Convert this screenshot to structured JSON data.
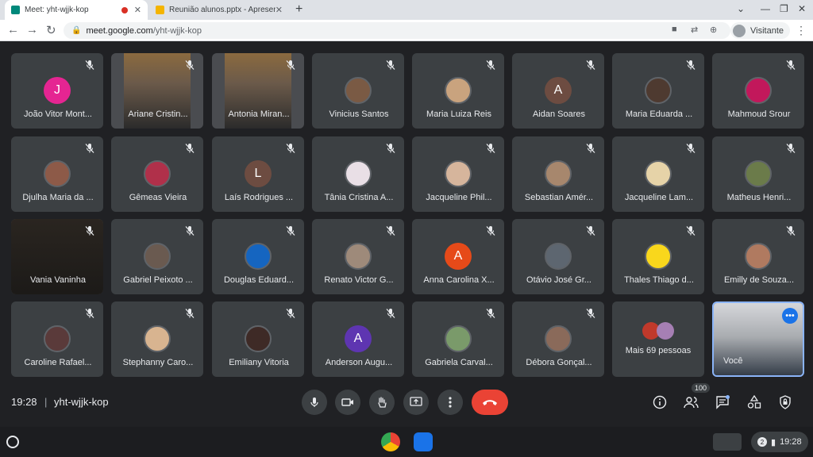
{
  "browser": {
    "tabs": [
      {
        "title": "Meet: yht-wjjk-kop",
        "recording": true
      },
      {
        "title": "Reunião alunos.pptx - Apresenta"
      }
    ],
    "url_host": "meet.google.com",
    "url_path": "/yht-wjjk-kop",
    "profile_label": "Visitante"
  },
  "participants": [
    {
      "name": "João Vitor Mont...",
      "type": "letter",
      "letter": "J",
      "color": "#e52592"
    },
    {
      "name": "Ariane Cristin...",
      "type": "video"
    },
    {
      "name": "Antonia Miran...",
      "type": "video"
    },
    {
      "name": "Vinicius Santos",
      "type": "photo",
      "color": "#7a5a44"
    },
    {
      "name": "Maria Luiza Reis",
      "type": "photo",
      "color": "#c9a37e"
    },
    {
      "name": "Aidan Soares",
      "type": "letter",
      "letter": "A",
      "color": "#6d4c41"
    },
    {
      "name": "Maria Eduarda ...",
      "type": "photo",
      "color": "#4e3a30"
    },
    {
      "name": "Mahmoud Srour",
      "type": "photo",
      "color": "#c2185b"
    },
    {
      "name": "Djulha Maria da ...",
      "type": "photo",
      "color": "#8d5a48"
    },
    {
      "name": "Gêmeas Vieira",
      "type": "photo",
      "color": "#b0304a"
    },
    {
      "name": "Laís Rodrigues ...",
      "type": "letter",
      "letter": "L",
      "color": "#6d4c41"
    },
    {
      "name": "Tânia Cristina A...",
      "type": "photo",
      "color": "#e9dfe6"
    },
    {
      "name": "Jacqueline Phil...",
      "type": "photo",
      "color": "#d6b59c"
    },
    {
      "name": "Sebastian Amér...",
      "type": "photo",
      "color": "#a7876d"
    },
    {
      "name": "Jacqueline Lam...",
      "type": "photo",
      "color": "#e6d3a8"
    },
    {
      "name": "Matheus Henri...",
      "type": "photo",
      "color": "#6b7b4a"
    },
    {
      "name": "Vania Vaninha",
      "type": "dark"
    },
    {
      "name": "Gabriel Peixoto ...",
      "type": "photo",
      "color": "#6a5a50"
    },
    {
      "name": "Douglas Eduard...",
      "type": "photo",
      "color": "#1565c0"
    },
    {
      "name": "Renato Victor G...",
      "type": "photo",
      "color": "#9e8a7a"
    },
    {
      "name": "Anna Carolina X...",
      "type": "letter",
      "letter": "A",
      "color": "#e64a19"
    },
    {
      "name": "Otávio José Gr...",
      "type": "photo",
      "color": "#5d6670"
    },
    {
      "name": "Thales Thiago d...",
      "type": "photo",
      "color": "#f9d71c"
    },
    {
      "name": "Emilly de Souza...",
      "type": "photo",
      "color": "#b07a60"
    },
    {
      "name": "Caroline Rafael...",
      "type": "photo",
      "color": "#5a3a3a"
    },
    {
      "name": "Stephanny Caro...",
      "type": "photo",
      "color": "#d8b490"
    },
    {
      "name": "Emiliany Vitoria",
      "type": "photo",
      "color": "#3e2a26"
    },
    {
      "name": "Anderson Augu...",
      "type": "letter",
      "letter": "A",
      "color": "#5e35b1"
    },
    {
      "name": "Gabriela Carval...",
      "type": "photo",
      "color": "#7a9a6a"
    },
    {
      "name": "Débora Gonçal...",
      "type": "photo",
      "color": "#8a6a5a"
    },
    {
      "name": "Mais 69 pessoas",
      "type": "more"
    },
    {
      "name": "Você",
      "type": "self"
    }
  ],
  "meeting": {
    "time": "19:28",
    "separator": "|",
    "code": "yht-wjjk-kop",
    "people_count": "100"
  },
  "shelf": {
    "time": "19:28",
    "notifications": "2"
  }
}
